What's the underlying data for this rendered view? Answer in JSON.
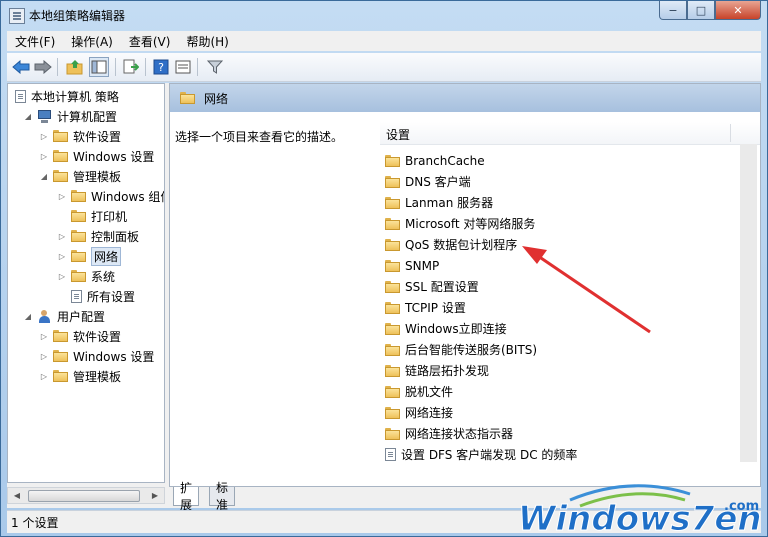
{
  "window": {
    "title": "本地组策略编辑器",
    "min_glyph": "−",
    "max_glyph": "□",
    "close_glyph": "✕"
  },
  "menu": [
    "文件(F)",
    "操作(A)",
    "查看(V)",
    "帮助(H)"
  ],
  "tree": {
    "root": "本地计算机 策略",
    "computer_config": "计算机配置",
    "computer_children": [
      "软件设置",
      "Windows 设置",
      "管理模板"
    ],
    "admin_templates_children": [
      "Windows 组件",
      "打印机",
      "控制面板",
      "网络",
      "系统",
      "所有设置"
    ],
    "user_config": "用户配置",
    "user_children": [
      "软件设置",
      "Windows 设置",
      "管理模板"
    ]
  },
  "right": {
    "header_title": "网络",
    "description": "选择一个项目来查看它的描述。",
    "column_header": "设置",
    "items": [
      "BranchCache",
      "DNS 客户端",
      "Lanman 服务器",
      "Microsoft 对等网络服务",
      "QoS 数据包计划程序",
      "SNMP",
      "SSL 配置设置",
      "TCPIP 设置",
      "Windows立即连接",
      "后台智能传送服务(BITS)",
      "链路层拓扑发现",
      "脱机文件",
      "网络连接",
      "网络连接状态指示器"
    ],
    "setting_item": "设置 DFS 客户端发现 DC 的频率"
  },
  "tabs": [
    "扩展",
    "标准"
  ],
  "status": "1 个设置",
  "watermark": {
    "text": "Windows7en",
    "domain": ".com"
  },
  "colors": {
    "arrow": "#e03030",
    "header": "#a7c0de",
    "folder": "#eec15a"
  }
}
